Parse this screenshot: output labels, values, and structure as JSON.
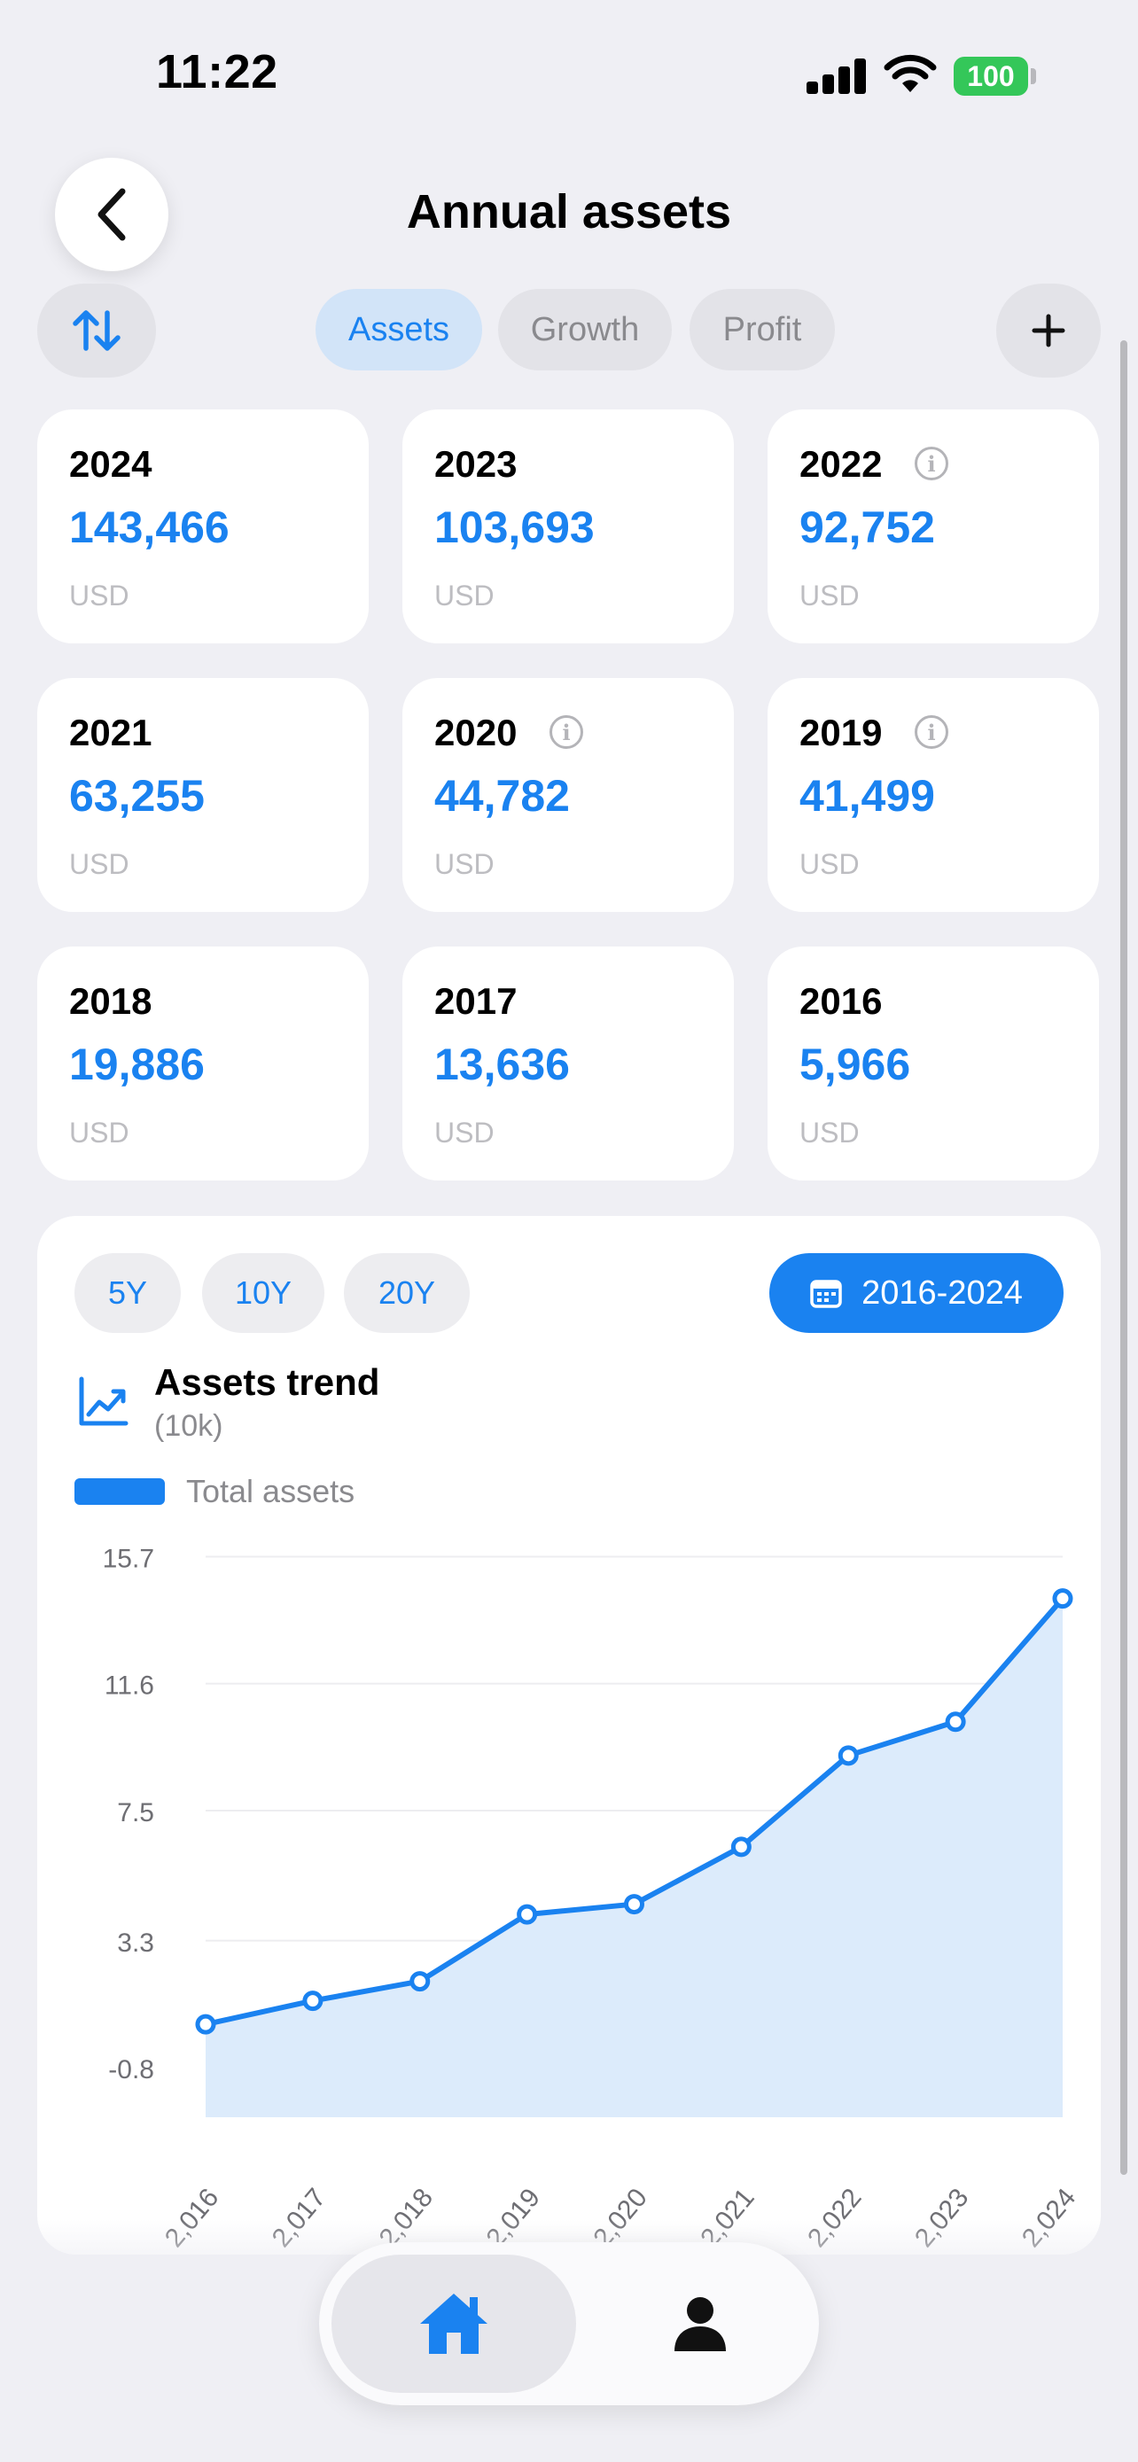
{
  "status": {
    "time": "11:22",
    "battery": "100"
  },
  "header": {
    "title": "Annual assets"
  },
  "toolbar": {
    "tabs": [
      {
        "label": "Assets",
        "selected": true
      },
      {
        "label": "Growth",
        "selected": false
      },
      {
        "label": "Profit",
        "selected": false
      }
    ]
  },
  "cards": [
    {
      "year": "2024",
      "value": "143,466",
      "unit": "USD",
      "info": false
    },
    {
      "year": "2023",
      "value": "103,693",
      "unit": "USD",
      "info": false
    },
    {
      "year": "2022",
      "value": "92,752",
      "unit": "USD",
      "info": true
    },
    {
      "year": "2021",
      "value": "63,255",
      "unit": "USD",
      "info": false
    },
    {
      "year": "2020",
      "value": "44,782",
      "unit": "USD",
      "info": true
    },
    {
      "year": "2019",
      "value": "41,499",
      "unit": "USD",
      "info": true
    },
    {
      "year": "2018",
      "value": "19,886",
      "unit": "USD",
      "info": false
    },
    {
      "year": "2017",
      "value": "13,636",
      "unit": "USD",
      "info": false
    },
    {
      "year": "2016",
      "value": "5,966",
      "unit": "USD",
      "info": false
    }
  ],
  "trend": {
    "ranges": [
      "5Y",
      "10Y",
      "20Y"
    ],
    "date_range": "2016-2024",
    "title": "Assets trend",
    "subtitle": "(10k)",
    "legend": "Total assets"
  },
  "chart_data": {
    "type": "area",
    "title": "Assets trend",
    "subtitle": "(10k)",
    "x": [
      "2,016",
      "2,017",
      "2,018",
      "2,019",
      "2,020",
      "2,021",
      "2,022",
      "2,023",
      "2,024"
    ],
    "series": [
      {
        "name": "Total assets",
        "values": [
          0.6,
          1.36,
          1.99,
          4.15,
          4.48,
          6.33,
          9.28,
          10.37,
          14.35
        ]
      }
    ],
    "yticks": [
      "15.7",
      "11.6",
      "7.5",
      "3.3",
      "-0.8"
    ],
    "ylim": [
      -2.4,
      16.4
    ],
    "grid": true,
    "legend_position": "top-left",
    "colors": {
      "line": "#1a82f0",
      "fill": "#dcebfb"
    }
  },
  "tabbar": {
    "items": [
      "home",
      "profile"
    ]
  }
}
